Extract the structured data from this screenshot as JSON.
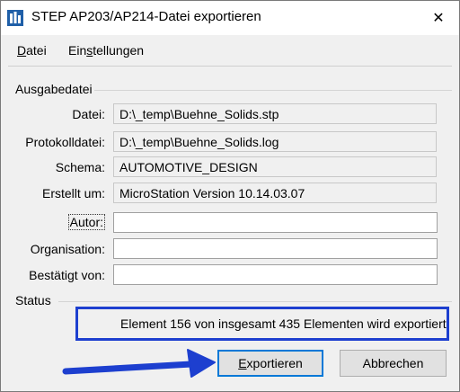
{
  "window": {
    "title": "STEP AP203/AP214-Datei exportieren",
    "close_symbol": "✕",
    "icon": "step-export-icon"
  },
  "menu": {
    "items": [
      {
        "mnemonic": "D",
        "rest": "atei"
      },
      {
        "pre": "Ein",
        "mnemonic": "s",
        "rest": "tellungen"
      }
    ]
  },
  "output_group": {
    "title": "Ausgabedatei",
    "fields": [
      {
        "label": "Datei:",
        "value": "D:\\_temp\\Buehne_Solids.stp"
      },
      {
        "label": "Protokolldatei:",
        "value": "D:\\_temp\\Buehne_Solids.log"
      },
      {
        "label": "Schema:",
        "value": "AUTOMOTIVE_DESIGN"
      },
      {
        "label": "Erstellt um:",
        "value": "MicroStation Version 10.14.03.07"
      }
    ],
    "inputs": [
      {
        "label": "Autor:",
        "value": "",
        "placeholder": ""
      },
      {
        "label": "Organisation:",
        "value": "",
        "placeholder": ""
      },
      {
        "label": "Bestätigt von:",
        "value": "",
        "placeholder": ""
      }
    ]
  },
  "status_group": {
    "title": "Status",
    "message": "Element 156 von insgesamt 435 Elementen wird exportiert"
  },
  "buttons": {
    "export": {
      "mnemonic": "E",
      "rest": "xportieren"
    },
    "cancel": {
      "label": "Abbrechen"
    }
  },
  "colors": {
    "highlight_blue": "#1d3fcf",
    "focus_blue": "#0078d7"
  }
}
